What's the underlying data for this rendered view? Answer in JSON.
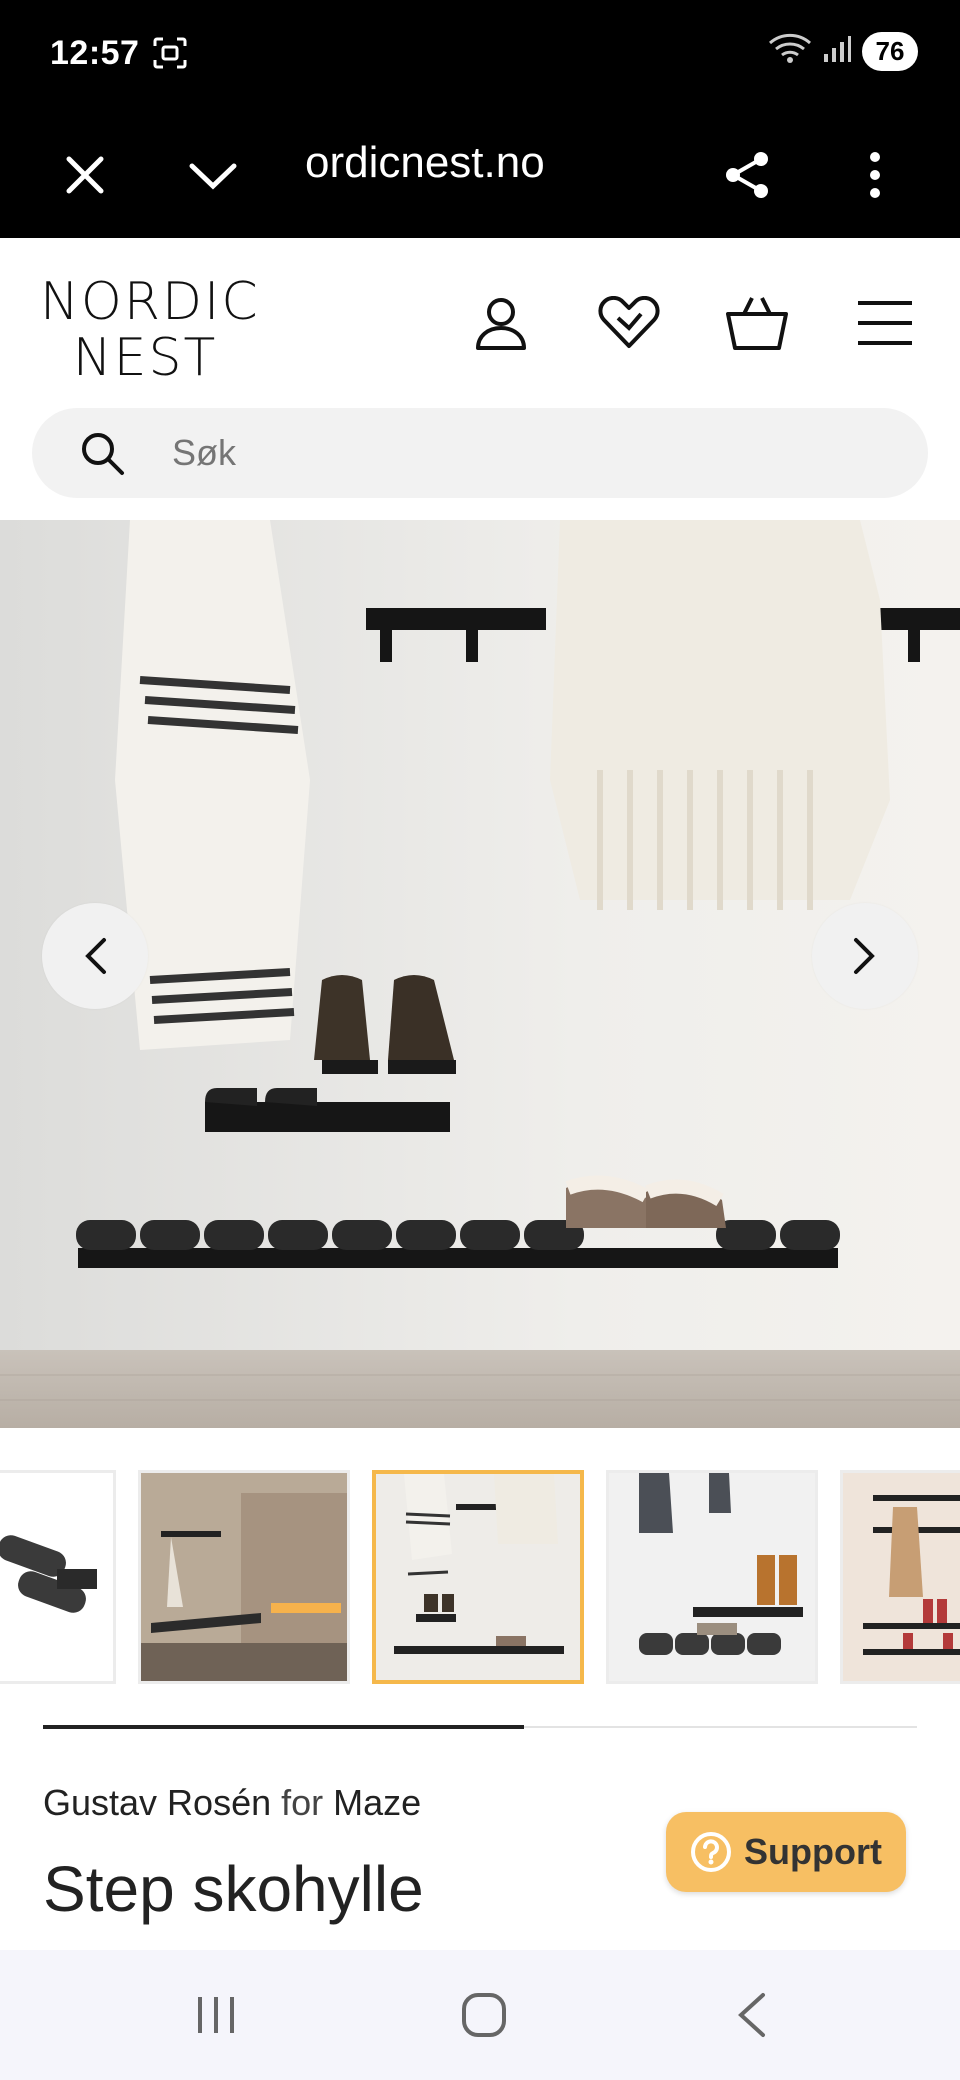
{
  "status_bar": {
    "time": "12:57",
    "battery": "76",
    "icons": [
      "screenshot-icon",
      "wifi-icon",
      "signal-icon"
    ]
  },
  "browser": {
    "url": "ordicnest.no",
    "icons": [
      "close-icon",
      "chevron-down-icon",
      "share-icon",
      "more-vertical-icon"
    ]
  },
  "header": {
    "logo_line1": "NORDIC",
    "logo_line2": "NEST",
    "icons": [
      "account-icon",
      "wishlist-heart-icon",
      "basket-icon",
      "menu-icon"
    ]
  },
  "search": {
    "placeholder": "Søk"
  },
  "gallery": {
    "active_thumbnail": 3,
    "thumbnail_count": 5,
    "scroll_progress": 0.55
  },
  "product": {
    "designer": "Gustav Rosén",
    "for_word": "for",
    "brand": "Maze",
    "title": "Step skohylle"
  },
  "support": {
    "label": "Support"
  },
  "colors": {
    "accent": "#f5b84b",
    "support_bg": "#f7bf63",
    "text": "#222222"
  }
}
